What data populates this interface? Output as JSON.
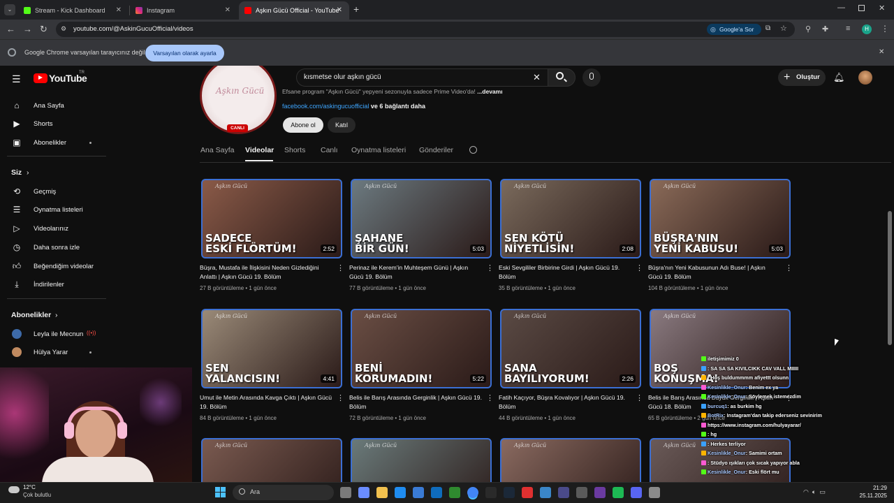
{
  "browser": {
    "tabs": [
      {
        "title": "Stream - Kick Dashboard",
        "color": "#53fc18"
      },
      {
        "title": "Instagram",
        "color": "#e1306c"
      },
      {
        "title": "Aşkın Gücü Official - YouTube",
        "color": "#ff0000"
      }
    ],
    "url": "youtube.com/@AskinGucuOfficial/videos",
    "google_label": "Google'a Sor",
    "profile_initial": "H",
    "infobar_text": "Google Chrome varsayılan tarayıcınız değil",
    "infobar_button": "Varsayılan olarak ayarla"
  },
  "youtube": {
    "logo": "YouTube",
    "logo_sup": "TR",
    "search_value": "kısmetse olur aşkın gücü",
    "create_label": "Oluştur",
    "sidebar_main": [
      {
        "label": "Ana Sayfa",
        "icon": "home-icon"
      },
      {
        "label": "Shorts",
        "icon": "shorts-icon"
      },
      {
        "label": "Abonelikler",
        "icon": "subscriptions-icon"
      }
    ],
    "you_heading": "Siz",
    "sidebar_you": [
      {
        "label": "Geçmiş",
        "icon": "history-icon"
      },
      {
        "label": "Oynatma listeleri",
        "icon": "playlists-icon"
      },
      {
        "label": "Videolarınız",
        "icon": "your-videos-icon"
      },
      {
        "label": "Daha sonra izle",
        "icon": "watch-later-icon"
      },
      {
        "label": "Beğendiğim videolar",
        "icon": "liked-icon"
      },
      {
        "label": "İndirilenler",
        "icon": "downloads-icon"
      }
    ],
    "subs_heading": "Abonelikler",
    "subscriptions": [
      {
        "label": "Leyla ile Mecnun",
        "live": true
      },
      {
        "label": "Hülya Yarar",
        "live": false
      }
    ],
    "channel": {
      "description": "Efsane program \"Aşkın Gücü\" yepyeni sezonuyla sadece Prime Video'da!",
      "more": "...devamı",
      "link": "facebook.com/askingucuofficial",
      "link_more": "ve 6 bağlantı daha",
      "live_badge": "CANLI",
      "avatar_text": "Aşkın Gücü",
      "subscribe": "Abone ol",
      "join": "Katıl"
    },
    "nav_tabs": [
      "Ana Sayfa",
      "Videolar",
      "Shorts",
      "Canlı",
      "Oynatma listeleri",
      "Gönderiler"
    ],
    "active_tab": "Videolar",
    "watermark": "Aşkın Gücü",
    "videos": [
      {
        "caption": "SADECE\nESKİ FLÖRTÜM!",
        "duration": "2:52",
        "title": "Büşra, Mustafa ile İlişkisini Neden Gizlediğini Anlattı | Aşkın Gücü 19. Bölüm",
        "views": "27 B görüntüleme",
        "age": "1 gün önce",
        "bg": "#8a5a48"
      },
      {
        "caption": "ŞAHANE\nBİR GÜN!",
        "duration": "5:03",
        "title": "Perinaz ile Kerem'in Muhteşem Günü | Aşkın Gücü 19. Bölüm",
        "views": "77 B görüntüleme",
        "age": "1 gün önce",
        "bg": "#6c7a80"
      },
      {
        "caption": "SEN KÖTÜ\nNİYETLİSİN!",
        "duration": "2:08",
        "title": "Eski Sevgililer Birbirine Girdi | Aşkın Gücü 19. Bölüm",
        "views": "35 B görüntüleme",
        "age": "1 gün önce",
        "bg": "#7a6a5c"
      },
      {
        "caption": "BÜŞRA'NIN\nYENİ KABUSU!",
        "duration": "5:03",
        "title": "Büşra'nın Yeni Kabusunun Adı Buse! | Aşkın Gücü 19. Bölüm",
        "views": "104 B görüntüleme",
        "age": "1 gün önce",
        "bg": "#8a6a58"
      },
      {
        "caption": "SEN\nYALANCISIN!",
        "duration": "4:41",
        "title": "Umut ile Metin Arasında Kavga Çıktı | Aşkın Gücü 19. Bölüm",
        "views": "84 B görüntüleme",
        "age": "1 gün önce",
        "bg": "#9a8a78"
      },
      {
        "caption": "BENİ\nKORUMADIN!",
        "duration": "5:22",
        "title": "Belis ile Barış Arasında Gerginlik | Aşkın Gücü 19. Bölüm",
        "views": "72 B görüntüleme",
        "age": "1 gün önce",
        "bg": "#6a4e44"
      },
      {
        "caption": "SANA\nBAYILIYORUM!",
        "duration": "2:26",
        "title": "Fatih Kaçıyor, Büşra Kovalıyor | Aşkın Gücü 19. Bölüm",
        "views": "44 B görüntüleme",
        "age": "1 gün önce",
        "bg": "#5a4a44"
      },
      {
        "caption": "BOŞ\nKONUŞMA!",
        "duration": "",
        "title": "Belis ile Barış Arasında Büyük Gerginlik | Aşkın Gücü 18. Bölüm",
        "views": "65 B görüntüleme",
        "age": "2 gün önce",
        "bg": "#8a7a80"
      }
    ],
    "row3_bg": [
      "#7a5a50",
      "#6a7a7a",
      "#8a6a60",
      "#6a5a58"
    ]
  },
  "chat": [
    {
      "user": "",
      "text": "iletişimimiz 0"
    },
    {
      "user": "",
      "text": ": SA SA SA KIVILCIKK CAV VALL MIIIII"
    },
    {
      "user": "",
      "text": ": Hoş buldummmm afiyettt olsunn"
    },
    {
      "user": "Kesinlikle_Onur",
      "text": ": Benim ex ya"
    },
    {
      "user": "Kesinlikle_Onur",
      "text": ": Söylemek istemezdim"
    },
    {
      "user": "burcuq1",
      "text": ": as burkim hg"
    },
    {
      "user": "BotRix",
      "text": ": Instagram'dan takip ederseniz sevinirim"
    },
    {
      "user": "",
      "text": "https://www.instagram.com/hulyayarar/"
    },
    {
      "user": "",
      "text": ": hg"
    },
    {
      "user": "",
      "text": ": Herkes terliyor"
    },
    {
      "user": "Kesinlikle_Onur",
      "text": ": Samimi ortam"
    },
    {
      "user": "",
      "text": ": Stüdyo ışıkları çok sıcak yapıyor abla"
    },
    {
      "user": "Kesinlikle_Onur",
      "text": ": Eski flört mu"
    }
  ],
  "taskbar": {
    "weather_temp": "12°C",
    "weather_desc": "Çok bulutlu",
    "search_placeholder": "Ara",
    "time": "21:29",
    "date": "25.11.2025"
  }
}
